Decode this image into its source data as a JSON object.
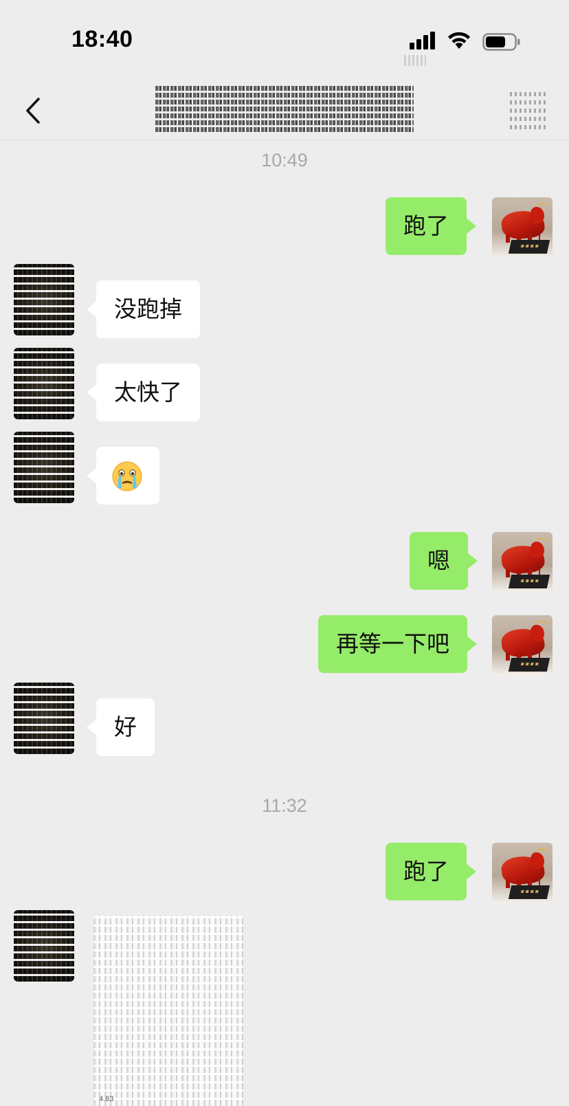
{
  "status_bar": {
    "time": "18:40",
    "icons": [
      "signal-icon",
      "wifi-icon",
      "battery-icon"
    ]
  },
  "nav": {
    "back_icon": "chevron-left-icon",
    "title": "",
    "more_icon": "more-icon"
  },
  "colors": {
    "background": "#ededed",
    "self_bubble": "#95ec69",
    "other_bubble": "#ffffff",
    "timestamp": "#a8a8a8"
  },
  "messages": [
    {
      "type": "timestamp",
      "text": "10:49"
    },
    {
      "type": "text",
      "sender": "self",
      "text": "跑了"
    },
    {
      "type": "text",
      "sender": "other",
      "text": "没跑掉"
    },
    {
      "type": "text",
      "sender": "other",
      "text": "太快了"
    },
    {
      "type": "emoji",
      "sender": "other",
      "emoji": "crying-face-icon"
    },
    {
      "type": "text",
      "sender": "self",
      "text": "嗯"
    },
    {
      "type": "text",
      "sender": "self",
      "text": "再等一下吧"
    },
    {
      "type": "text",
      "sender": "other",
      "text": "好"
    },
    {
      "type": "timestamp",
      "text": "11:32"
    },
    {
      "type": "text",
      "sender": "self",
      "text": "跑了"
    },
    {
      "type": "image",
      "sender": "other",
      "caption": "4.63"
    }
  ]
}
